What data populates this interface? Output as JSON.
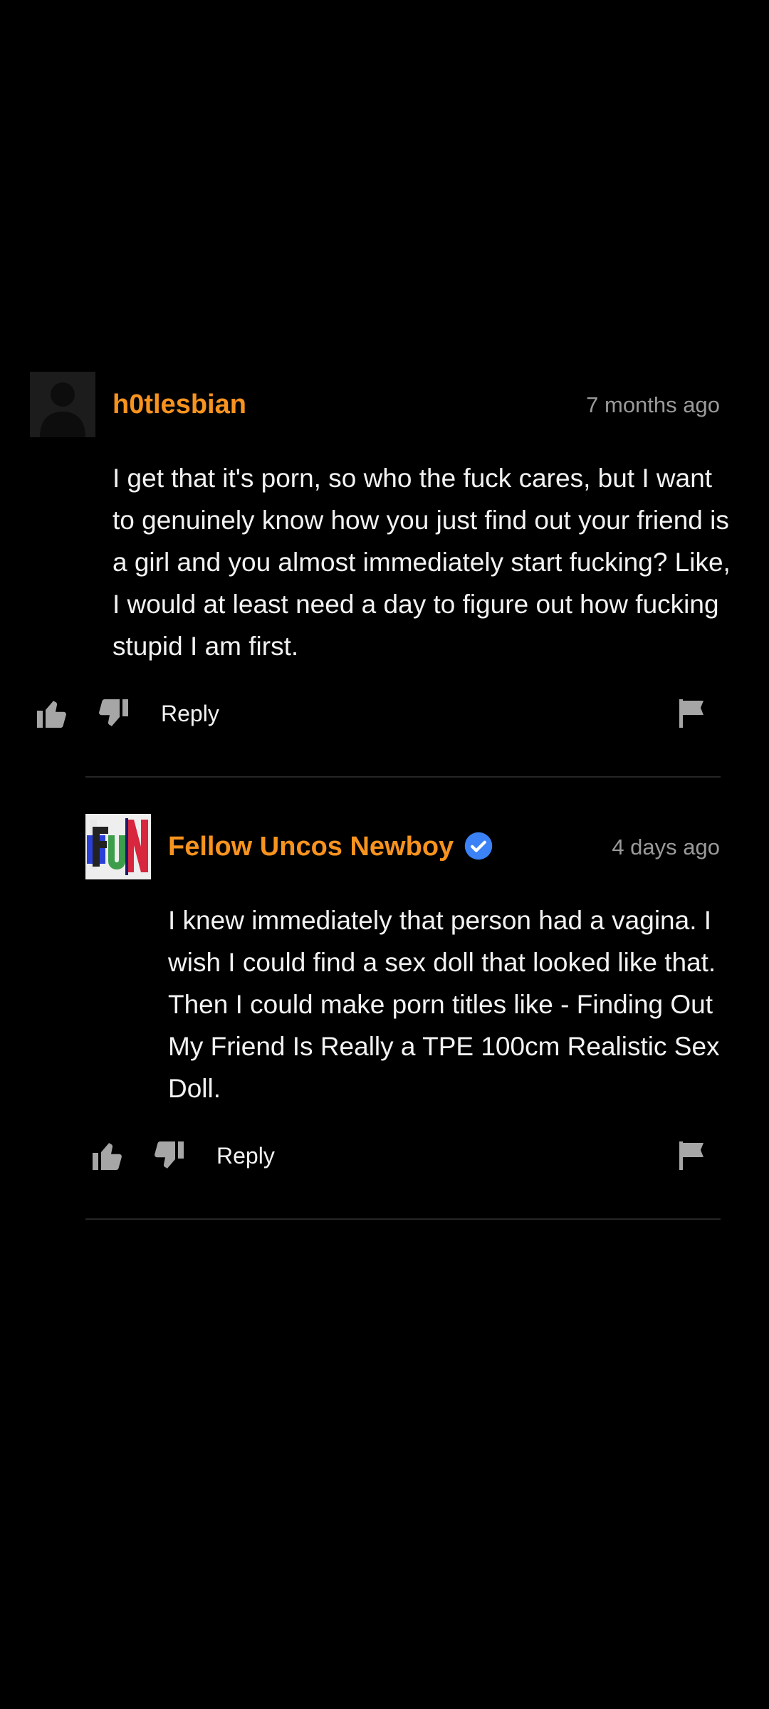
{
  "comments": [
    {
      "username": "h0tlesbian",
      "time": "7 months ago",
      "text": "I get that it's porn, so who the fuck cares, but I want to genuinely know how you just find out your friend is a girl and you almost immediately start fucking? Like, I would at least need a day to figure out how fucking stupid I am first.",
      "avatar": "default-user-avatar",
      "verified": false,
      "actions": {
        "reply_label": "Reply"
      }
    },
    {
      "username": "Fellow Uncos Newboy",
      "time": "4 days ago",
      "text": "I knew immediately that person had a vagina. I wish I could find a sex doll that looked like that. Then I could make porn titles like - Finding Out My Friend Is Really a TPE 100cm Realistic Sex Doll.",
      "avatar": "fun-logo-avatar",
      "verified": true,
      "actions": {
        "reply_label": "Reply"
      }
    }
  ],
  "colors": {
    "background": "#000000",
    "username": "#f7931e",
    "timestamp": "#9a9a9a",
    "text": "#f2f2f2",
    "icon": "#a6a6a6",
    "verified_badge": "#3b82f6",
    "divider": "#262626"
  },
  "icons": [
    "thumbs-up-icon",
    "thumbs-down-icon",
    "flag-icon",
    "verified-badge-icon"
  ]
}
